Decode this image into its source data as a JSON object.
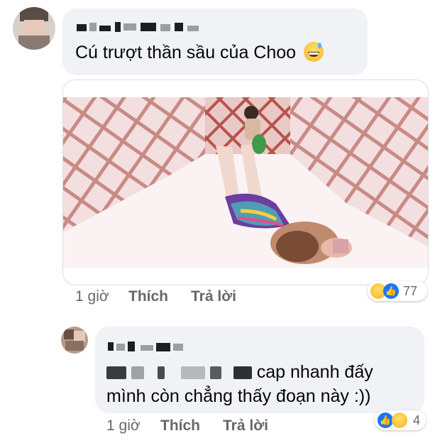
{
  "comments": [
    {
      "author": "",
      "text": "Cú trượt thần sầu của Choo",
      "emoji": "grinning-sweat-emoji",
      "time": "1 giờ",
      "like_label": "Thích",
      "reply_label": "Trả lời",
      "reaction_count": "77",
      "reactions": [
        "haha",
        "like"
      ]
    },
    {
      "author": "",
      "text_line1": "cap nhanh đấy",
      "text_line2": "mình còn chẳng thấy đoạn này :))",
      "time": "1 giờ",
      "like_label": "Thích",
      "reply_label": "Trả lời",
      "reaction_count": "4",
      "reactions": [
        "like",
        "haha"
      ]
    }
  ],
  "colors": {
    "bubble": "#f0f2f5",
    "action_text": "#65676b",
    "like_blue": "#1877f2"
  }
}
